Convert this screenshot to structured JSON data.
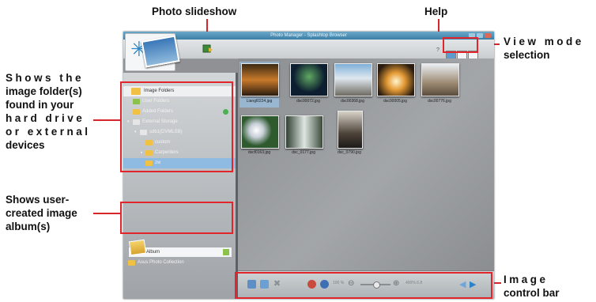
{
  "callouts": {
    "photo_slideshow": "Photo slideshow",
    "help": "Help",
    "view_mode_line1": "View mode",
    "view_mode_line2": "selection",
    "folders_l1": "Shows the",
    "folders_l2": "image folder(s)",
    "folders_l3": "found in your",
    "folders_l4": "hard drive",
    "folders_l5": "or external",
    "folders_l6": "devices",
    "album_l1": "Shows user-",
    "album_l2": "created image",
    "album_l3": "album(s)",
    "ctrl_l1": "Image",
    "ctrl_l2": "control bar"
  },
  "app": {
    "title": "Photo Manager - Splashtop Browser",
    "sidebar": {
      "folders": [
        {
          "label": "Image Folders",
          "selected": true
        },
        {
          "label": "User Folders"
        },
        {
          "label": "Added Folders"
        },
        {
          "label": "External Storage"
        },
        {
          "label": "sdb1(DVMLSB)"
        },
        {
          "label": "custom"
        },
        {
          "label": "Carpenters"
        },
        {
          "label": "zw"
        }
      ],
      "album": "Album",
      "asus_collection": "Asus Photo Collection"
    },
    "photos": [
      {
        "caption": "Liangl0224.jpg"
      },
      {
        "caption": "dsc00072.jpg"
      },
      {
        "caption": "dsc00368.jpg"
      },
      {
        "caption": "dsc00005.jpg"
      },
      {
        "caption": "dsc00776.jpg"
      },
      {
        "caption": "dscf0163.jpg"
      },
      {
        "caption": "dsc_0177.jpg"
      },
      {
        "caption": "dsc_0790.jpg"
      }
    ],
    "controls": {
      "zoom_percent": "100 %",
      "zoom_fit": "400% 6.8"
    }
  },
  "colors": {
    "callout_red": "#e2252b",
    "titlebar_blue": "#3d7fa6",
    "selection_blue": "#9cc4e8",
    "folder_yellow": "#f0c143"
  }
}
